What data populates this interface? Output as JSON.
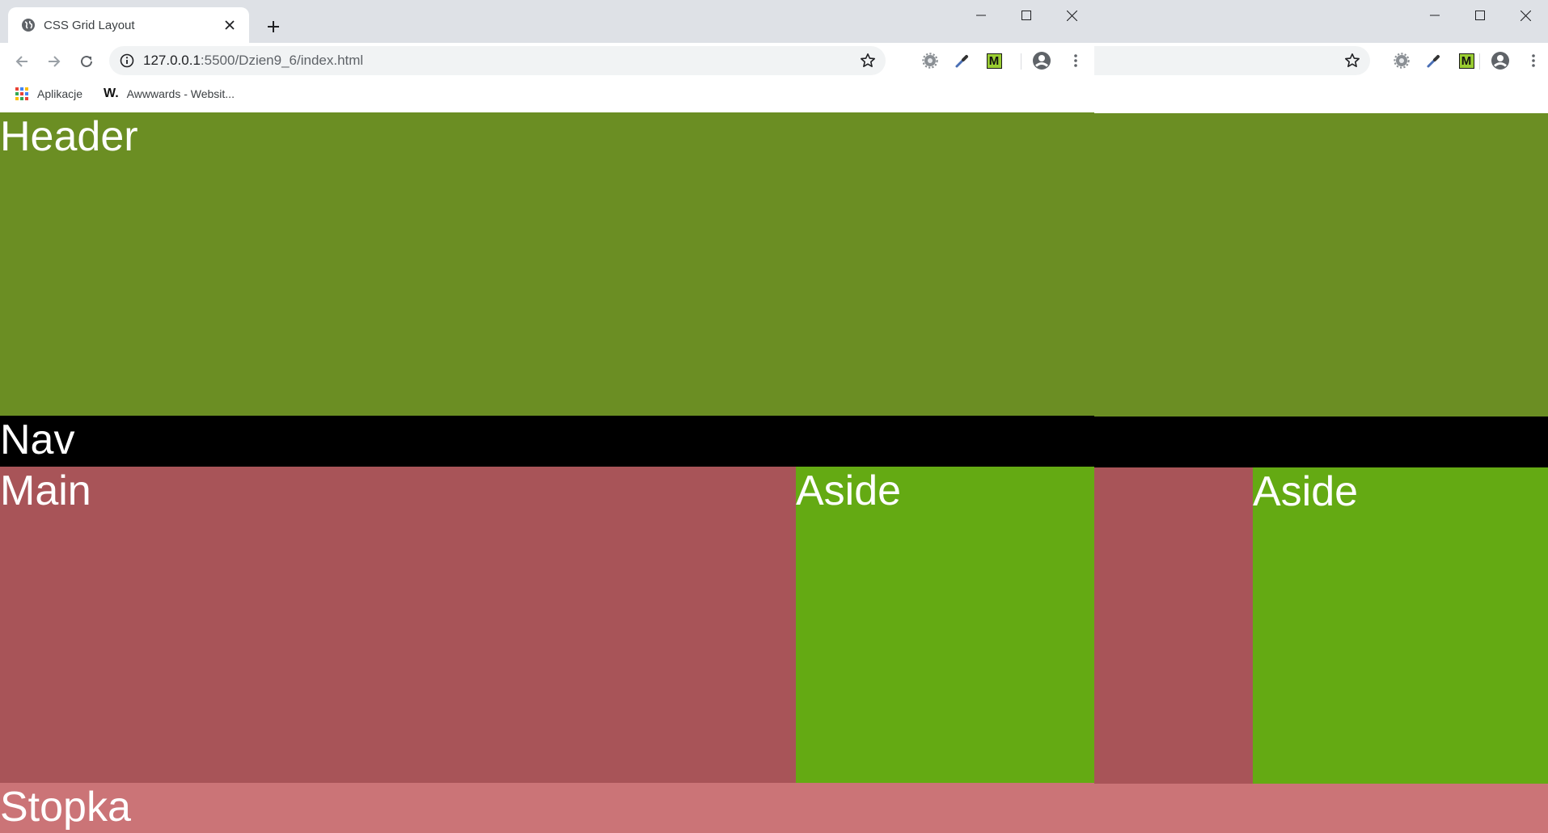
{
  "browser": {
    "tab_title": "CSS Grid Layout",
    "url_host": "127.0.0.1",
    "url_rest": ":5500/Dzien9_6/index.html",
    "bookmarks": [
      {
        "label": "Aplikacje",
        "icon": "apps-grid-icon"
      },
      {
        "label": "Awwwards - Websit...",
        "icon": "awwwards-logo-icon",
        "logo_text": "W."
      }
    ],
    "window_controls": [
      "minimize",
      "maximize",
      "close"
    ],
    "extensions": [
      "settings-extension-icon",
      "eyedropper-extension-icon",
      "m-extension-icon"
    ],
    "m_badge": "M"
  },
  "page": {
    "header": "Header",
    "nav": "Nav",
    "main": "Main",
    "aside": "Aside",
    "footer": "Stopka"
  },
  "colors": {
    "header": "#6b8e23",
    "nav": "#000000",
    "main": "#a85458",
    "aside": "#64aa13",
    "footer": "#cb7477"
  }
}
